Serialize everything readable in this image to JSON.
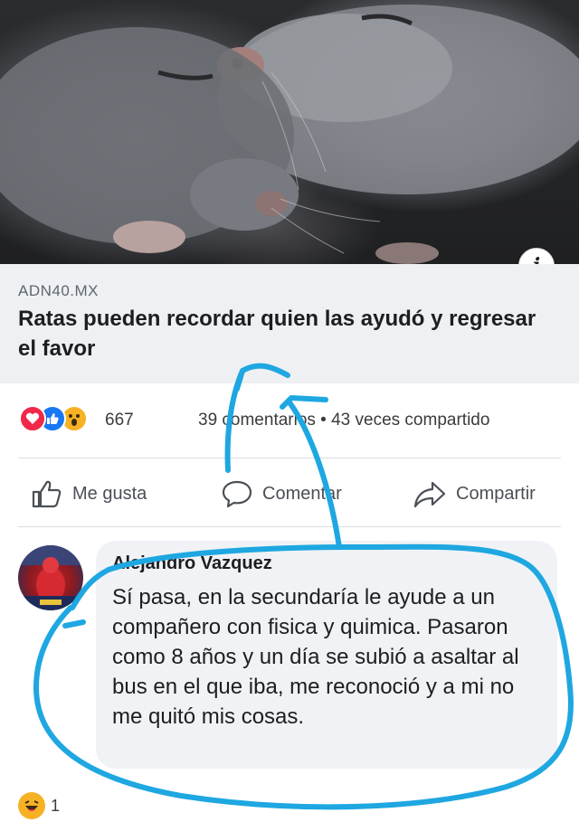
{
  "post": {
    "source": "ADN40.MX",
    "headline": "Ratas pueden recordar quien las ayudó y regresar el favor",
    "info_symbol": "i"
  },
  "reactions": {
    "icons": [
      "love-icon",
      "like-icon",
      "wow-icon"
    ],
    "count": "667",
    "comments_shares": "39 comentarios • 43 veces compartido"
  },
  "actions": {
    "like_label": "Me gusta",
    "comment_label": "Comentar",
    "share_label": "Compartir"
  },
  "comment": {
    "author": "Alejandro Vazquez",
    "text": "Sí pasa, en la secundaría le ayude a un compañero con fisica y quimica. Pasaron como 8 años y un día se subió a asaltar al bus en el que iba, me reconoció y a mi no me quitó mis cosas.",
    "reaction_icon": "haha-icon",
    "reaction_count": "1"
  },
  "colors": {
    "accent_blue": "#1877f2",
    "love_red": "#f0284a",
    "wow_yellow": "#f7b125",
    "scribble_cyan": "#1ea7e1"
  }
}
